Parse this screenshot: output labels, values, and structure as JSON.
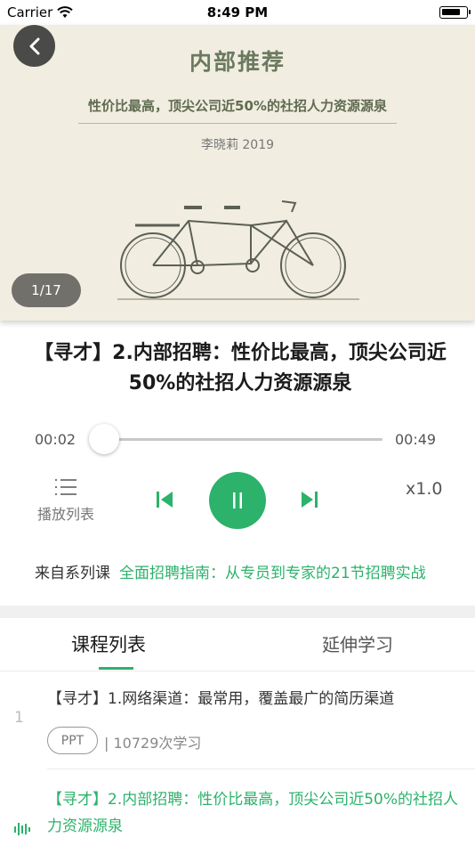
{
  "status_bar": {
    "carrier": "Carrier",
    "time": "8:49 PM"
  },
  "cover": {
    "title": "内部推荐",
    "subtitle": "性价比最高，顶尖公司近50%的社招人力资源源泉",
    "author": "李晓莉 2019",
    "page_indicator": "1/17",
    "illustration_icon": "tandem-bicycle-icon"
  },
  "player": {
    "track_title": "【寻才】2.内部招聘：性价比最高，顶尖公司近50%的社招人力资源源泉",
    "current_time": "00:02",
    "total_time": "00:49",
    "progress_fraction": 0.04,
    "playlist_label": "播放列表",
    "speed": "x1.0",
    "accent_color": "#2cb26b"
  },
  "series": {
    "label": "来自系列课",
    "name": "全面招聘指南：从专员到专家的21节招聘实战"
  },
  "tabs": [
    {
      "label": "课程列表",
      "active": true
    },
    {
      "label": "延伸学习",
      "active": false
    }
  ],
  "course_list": [
    {
      "index": "1",
      "title": "【寻才】1.网络渠道：最常用，覆盖最广的简历渠道",
      "badge": "PPT",
      "meta": "| 10729次学习"
    },
    {
      "index": "",
      "title": "【寻才】2.内部招聘：性价比最高，顶尖公司近50%的社招人力资源源泉",
      "playing": true
    }
  ]
}
